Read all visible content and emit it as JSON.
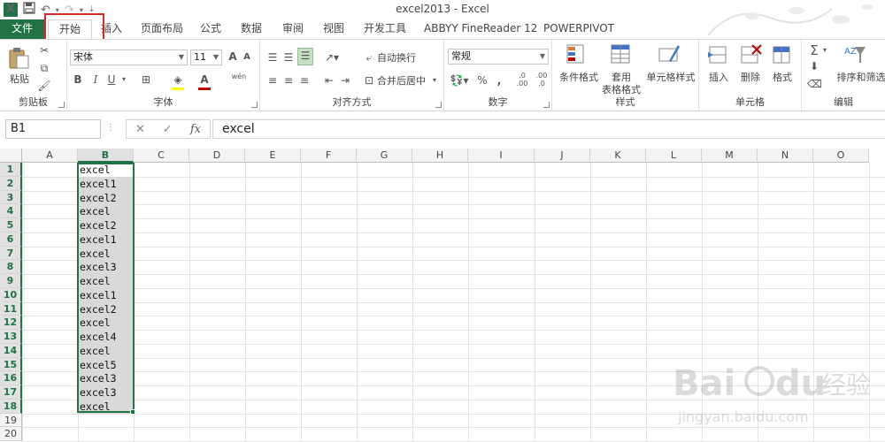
{
  "window": {
    "title": "excel2013 - Excel"
  },
  "tabs": [
    "文件",
    "开始",
    "插入",
    "页面布局",
    "公式",
    "数据",
    "审阅",
    "视图",
    "开发工具",
    "ABBYY FineReader 12",
    "POWERPIVOT"
  ],
  "ribbon": {
    "clipboard": {
      "label": "剪贴板",
      "paste": "粘贴"
    },
    "font": {
      "label": "字体",
      "name": "宋体",
      "size": "11",
      "bold": "B",
      "italic": "I",
      "underline": "U",
      "grow": "A",
      "shrink": "A",
      "wen": "wén",
      "font_color": "A"
    },
    "alignment": {
      "label": "对齐方式",
      "wrap": "自动换行",
      "merge": "合并后居中"
    },
    "number": {
      "label": "数字",
      "format": "常规",
      "percent": "%",
      "comma": ",",
      "inc_decimal": ".00",
      "dec_decimal": ".0"
    },
    "styles": {
      "label": "样式",
      "conditional": "条件格式",
      "table_a": "套用",
      "table_b": "表格格式",
      "cell_styles": "单元格样式"
    },
    "cells": {
      "label": "单元格",
      "insert": "插入",
      "delete": "删除",
      "format": "格式"
    },
    "editing": {
      "label": "编辑",
      "sort": "排序和筛选",
      "sum": "Σ"
    }
  },
  "formula_bar": {
    "name_box": "B1",
    "value": "excel",
    "fx": "fx",
    "cancel": "✕",
    "confirm": "✓"
  },
  "columns": [
    "A",
    "B",
    "C",
    "D",
    "E",
    "F",
    "G",
    "H",
    "I",
    "J",
    "K",
    "L",
    "M",
    "N",
    "O"
  ],
  "rows": [
    "1",
    "2",
    "3",
    "4",
    "5",
    "6",
    "7",
    "8",
    "9",
    "10",
    "11",
    "12",
    "13",
    "14",
    "15",
    "16",
    "17",
    "18",
    "19",
    "20"
  ],
  "column_b_values": [
    "excel",
    "excel1",
    "excel2",
    "excel",
    "excel2",
    "excel1",
    "excel",
    "excel3",
    "excel",
    "excel1",
    "excel2",
    "excel",
    "excel4",
    "excel",
    "excel5",
    "excel3",
    "excel3",
    "excel"
  ],
  "watermark": {
    "brand": "Baidu",
    "cn": "经验",
    "url": "jingyan.baidu.com"
  },
  "colors": {
    "accent": "#217346",
    "highlight": "#d42a2a",
    "selection": "#d9d9d9"
  }
}
